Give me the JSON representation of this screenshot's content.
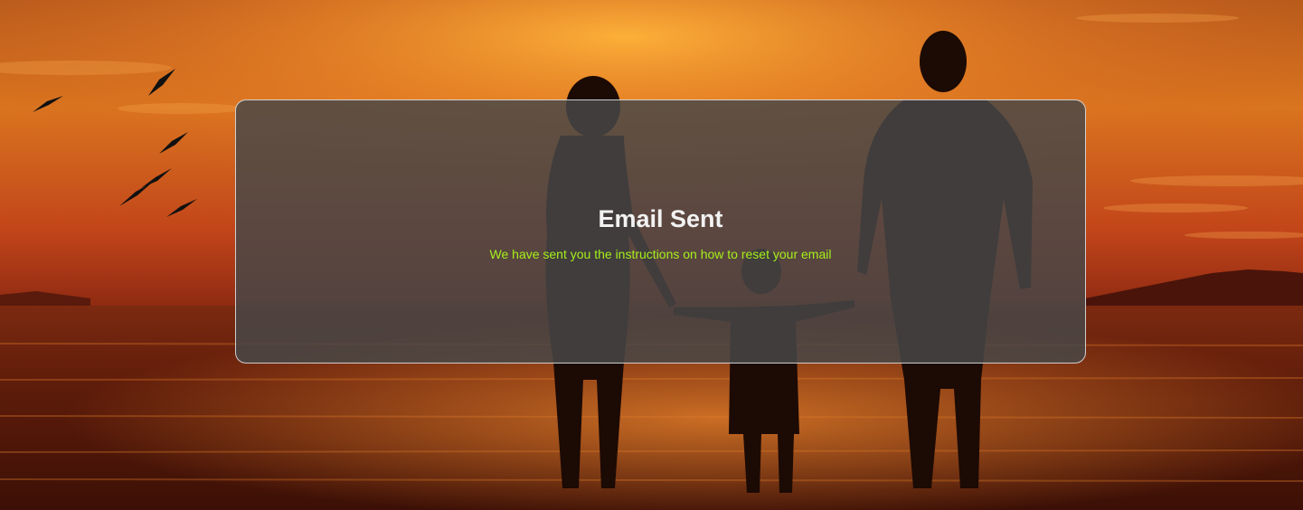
{
  "confirmation": {
    "title": "Email Sent",
    "message": "We have sent you the instructions on how to reset your email"
  },
  "theme": {
    "title_color": "#f2f2f2",
    "message_color": "#a6f01c",
    "card_background": "#484848",
    "card_border": "#e6e6e6",
    "sky_top": "#c8641e",
    "sun_color": "#f7a030",
    "sea_color": "#6a200c"
  },
  "background": {
    "icon": "sunset-beach-family-photo"
  }
}
